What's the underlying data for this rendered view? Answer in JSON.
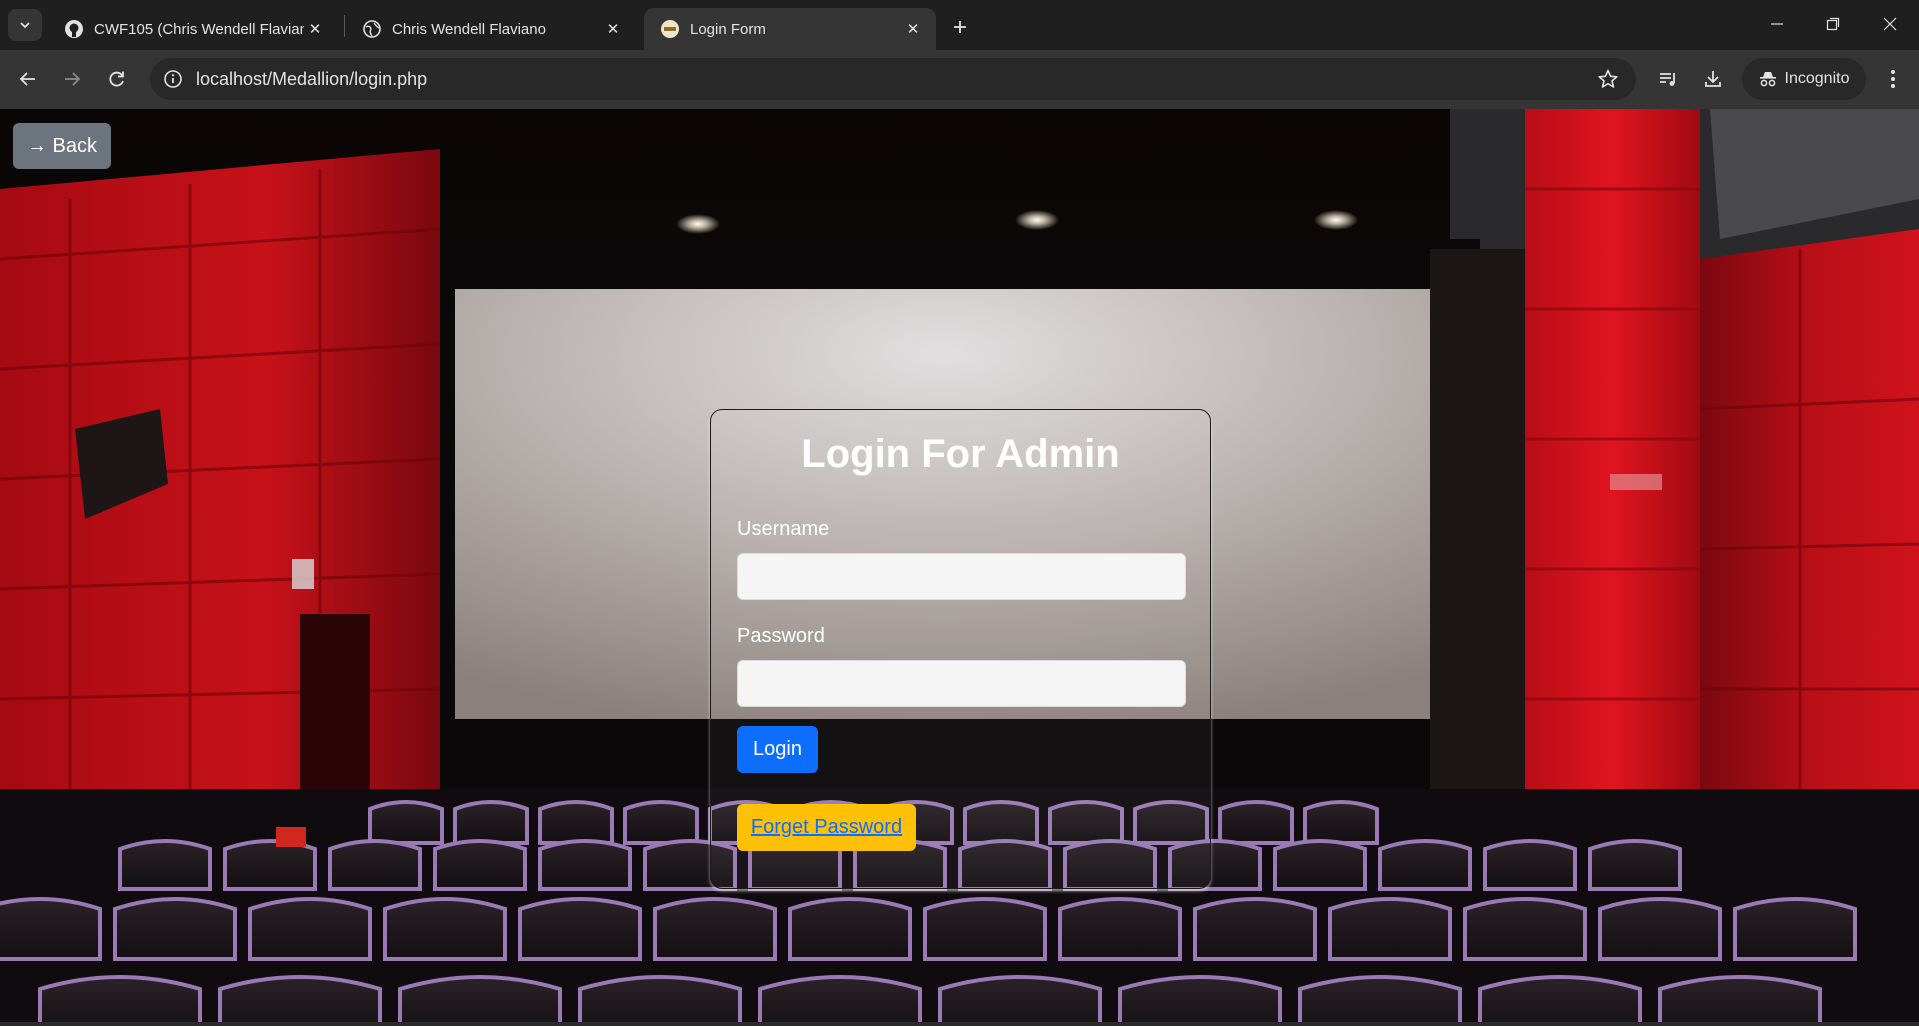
{
  "browser": {
    "tabs": [
      {
        "title": "CWF105 (Chris Wendell Flaviano",
        "icon": "github-icon",
        "active": false
      },
      {
        "title": "Chris Wendell Flaviano",
        "icon": "globe-icon",
        "active": false
      },
      {
        "title": "Login Form",
        "icon": "site-favicon",
        "active": true
      }
    ],
    "url": "localhost/Medallion/login.php",
    "incognito_label": "Incognito"
  },
  "page": {
    "back_label": "→ Back",
    "form": {
      "title": "Login For Admin",
      "username_label": "Username",
      "username_value": "",
      "password_label": "Password",
      "password_value": "",
      "login_label": "Login",
      "forget_label": "Forget Password"
    }
  },
  "colors": {
    "chrome_dark": "#1f1f1f",
    "chrome_toolbar": "#353535",
    "back_button": "#6c757d",
    "login_button": "#0d6efd",
    "forget_button": "#ffc107",
    "link": "#0d6efd",
    "theater_red": "#c4101a"
  }
}
